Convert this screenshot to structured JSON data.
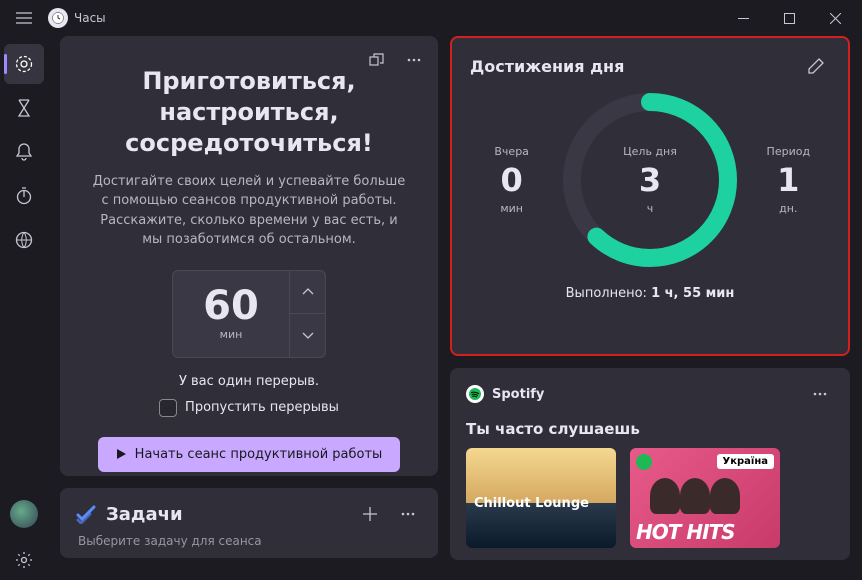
{
  "app": {
    "title": "Часы"
  },
  "focus": {
    "title": "Приготовиться, настроиться, сосредоточиться!",
    "description": "Достигайте своих целей и успевайте больше с помощью сеансов продуктивной работы. Расскажите, сколько времени у вас есть, и мы позаботимся об остальном.",
    "minutes": "60",
    "minutes_unit": "мин",
    "break_text": "У вас один перерыв.",
    "skip_label": "Пропустить перерывы",
    "start_label": "Начать сеанс продуктивной работы"
  },
  "tasks": {
    "title": "Задачи",
    "subtitle": "Выберите задачу для сеанса"
  },
  "achieve": {
    "title": "Достижения дня",
    "yesterday": {
      "label": "Вчера",
      "value": "0",
      "unit": "мин"
    },
    "goal": {
      "label": "Цель дня",
      "value": "3",
      "unit": "ч"
    },
    "period": {
      "label": "Период",
      "value": "1",
      "unit": "дн."
    },
    "done_label": "Выполнено:",
    "done_value": "1 ч, 55 мин",
    "progress_percent": 62
  },
  "spotify": {
    "brand": "Spotify",
    "subheader": "Ты часто слушаешь",
    "playlists": [
      {
        "cover_text": "Chillout Lounge",
        "badge": ""
      },
      {
        "cover_text": "HOT HITS",
        "badge": "Україна"
      }
    ]
  }
}
